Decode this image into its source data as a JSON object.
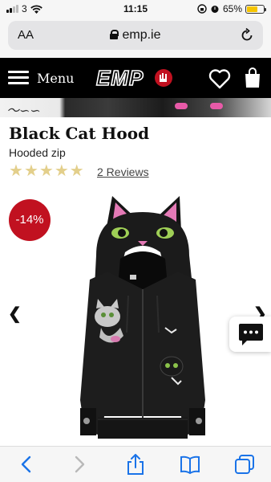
{
  "status_bar": {
    "carrier": "3",
    "time": "11:15",
    "battery_percent": "65%",
    "battery_level": 0.65,
    "battery_color": "#f5c400"
  },
  "address_bar": {
    "text_size_label": "AA",
    "url": "emp.ie",
    "icons": [
      "lock-icon",
      "reload-icon"
    ]
  },
  "nav": {
    "menu_label": "Menu",
    "logo_text": "EMP",
    "icons": [
      "hamburger-icon",
      "emp-logo",
      "heart-icon",
      "shopping-bag-icon"
    ]
  },
  "product": {
    "title": "Black Cat Hood",
    "subtitle": "Hooded zip",
    "rating": 5,
    "rating_max": 5,
    "reviews_label": "2 Reviews",
    "discount_badge": "-14%",
    "discount_color": "#c11120",
    "star_color": "#e3cf8b"
  },
  "browser_toolbar": {
    "icons": [
      "back-icon",
      "forward-icon",
      "share-icon",
      "bookmarks-icon",
      "tabs-icon"
    ],
    "accent": "#1a73e8"
  }
}
